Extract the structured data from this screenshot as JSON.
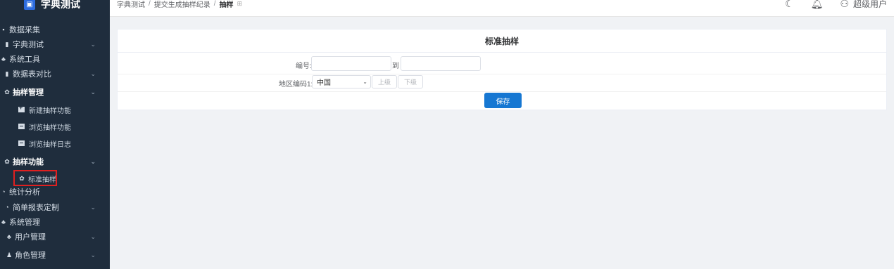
{
  "app": {
    "title": "字典测试"
  },
  "sidebar": {
    "items": [
      {
        "label": "数据采集"
      },
      {
        "label": "字典测试"
      },
      {
        "label": "系统工具"
      },
      {
        "label": "数据表对比"
      },
      {
        "label": "抽样管理"
      },
      {
        "label": "新建抽样功能"
      },
      {
        "label": "浏览抽样功能"
      },
      {
        "label": "浏览抽样日志"
      },
      {
        "label": "抽样功能"
      },
      {
        "label": "标准抽样"
      },
      {
        "label": "统计分析"
      },
      {
        "label": "简单报表定制"
      },
      {
        "label": "系统管理"
      },
      {
        "label": "用户管理"
      },
      {
        "label": "角色管理"
      }
    ]
  },
  "header": {
    "breadcrumb": [
      "字典测试",
      "提交生成抽样纪录",
      "抽样"
    ],
    "user": "超级用户"
  },
  "form": {
    "title": "标准抽样",
    "code_label": "编号:",
    "to_label": "到",
    "region_label": "地区编码1:",
    "region_value": "中国",
    "up_button": "上级",
    "down_button": "下级",
    "save_button": "保存"
  },
  "colors": {
    "sidebar_bg": "#1f2d3d",
    "primary": "#1677d2",
    "highlight": "#e02020"
  }
}
